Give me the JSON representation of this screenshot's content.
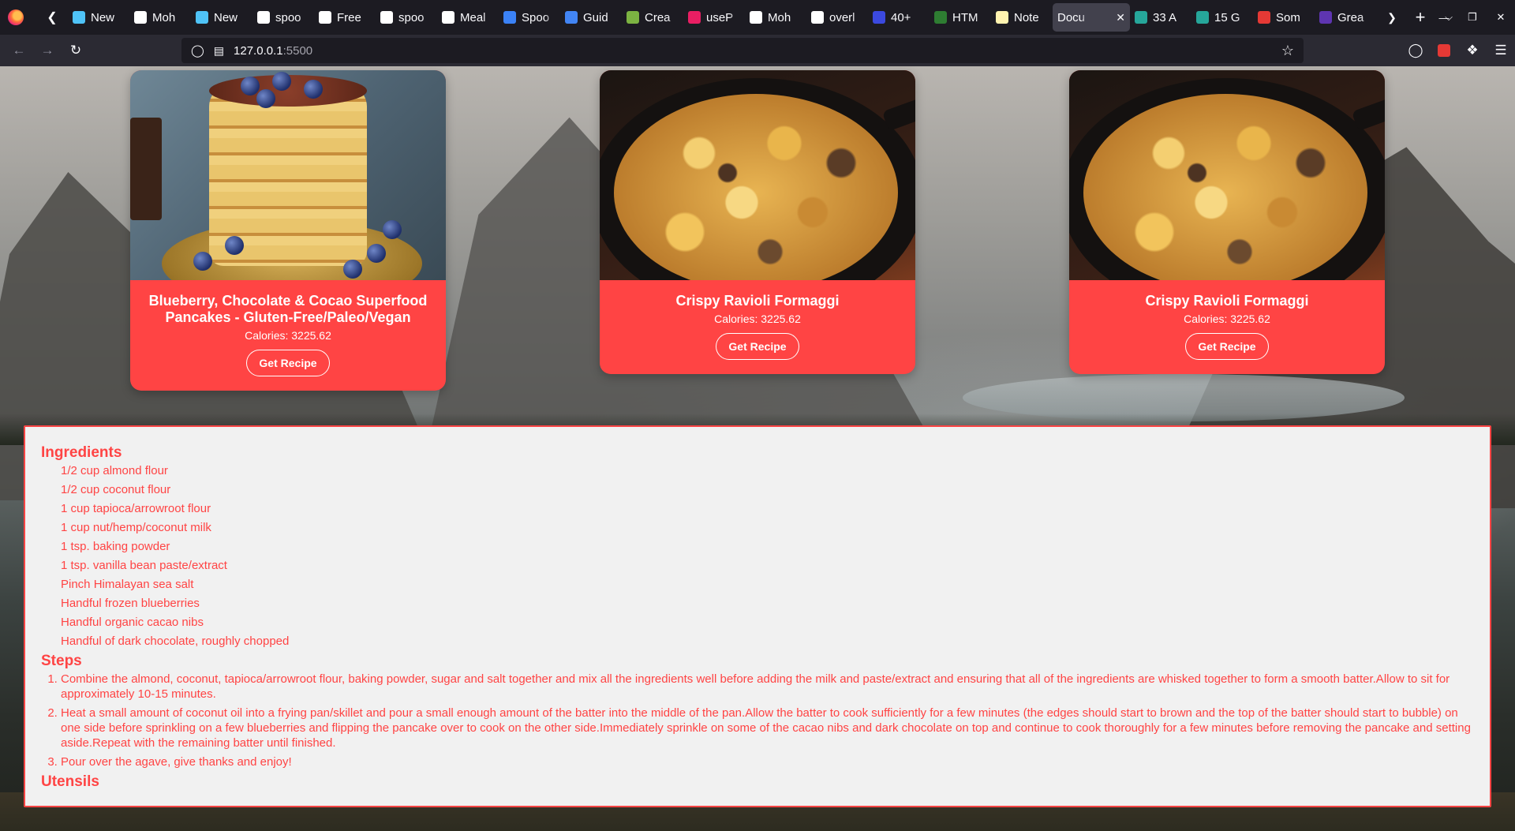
{
  "browser": {
    "tabs": [
      {
        "label": "New",
        "color": "#4fc3f7"
      },
      {
        "label": "Moh",
        "color": "#ffffff"
      },
      {
        "label": "New",
        "color": "#4fc3f7"
      },
      {
        "label": "spoo",
        "color": "#ffffff"
      },
      {
        "label": "Free",
        "color": "#ffffff"
      },
      {
        "label": "spoo",
        "color": "#ffffff"
      },
      {
        "label": "Meal",
        "color": "#ffffff"
      },
      {
        "label": "Spoo",
        "color": "#3b82f6"
      },
      {
        "label": "Guid",
        "color": "#4285f4"
      },
      {
        "label": "Crea",
        "color": "#7cb342"
      },
      {
        "label": "useP",
        "color": "#e91e63"
      },
      {
        "label": "Moh",
        "color": "#ffffff"
      },
      {
        "label": "overl",
        "color": "#ffffff"
      },
      {
        "label": "40+",
        "color": "#3b49df"
      },
      {
        "label": "HTM",
        "color": "#2e7d32"
      },
      {
        "label": "Note",
        "color": "#fff3b0"
      },
      {
        "label": "Docu",
        "color": "#42414d",
        "active": true
      },
      {
        "label": "33 A",
        "color": "#26a69a"
      },
      {
        "label": "15 G",
        "color": "#26a69a"
      },
      {
        "label": "Som",
        "color": "#e53935"
      },
      {
        "label": "Grea",
        "color": "#5e35b1"
      }
    ],
    "url_host": "127.0.0.1",
    "url_port": ":5500"
  },
  "cards": [
    {
      "title": "Blueberry, Chocolate & Cocao Superfood Pancakes - Gluten-Free/Paleo/Vegan",
      "calories": "Calories: 3225.62",
      "button": "Get Recipe",
      "image": "pancakes-photo"
    },
    {
      "title": "Crispy Ravioli Formaggi",
      "calories": "Calories: 3225.62",
      "button": "Get Recipe",
      "image": "ravioli-photo"
    },
    {
      "title": "Crispy Ravioli Formaggi",
      "calories": "Calories: 3225.62",
      "button": "Get Recipe",
      "image": "ravioli-photo"
    }
  ],
  "recipe": {
    "ingredients_heading": "Ingredients",
    "ingredients": [
      "1/2 cup almond flour",
      "1/2 cup coconut flour",
      "1 cup tapioca/arrowroot flour",
      "1 cup nut/hemp/coconut milk",
      "1 tsp. baking powder",
      "1 tsp. vanilla bean paste/extract",
      "Pinch Himalayan sea salt",
      "Handful frozen blueberries",
      "Handful organic cacao nibs",
      "Handful of dark chocolate, roughly chopped"
    ],
    "steps_heading": "Steps",
    "steps": [
      "Combine the almond, coconut, tapioca/arrowroot flour, baking powder, sugar and salt together and mix all the ingredients well before adding the milk and paste/extract and ensuring that all of the ingredients are whisked together to form a smooth batter.Allow to sit for approximately 10-15 minutes.",
      "Heat a small amount of coconut oil into a frying pan/skillet and pour a small enough amount of the batter into the middle of the pan.Allow the batter to cook sufficiently for a few minutes (the edges should start to brown and the top of the batter should start to bubble) on one side before sprinkling on a few blueberries and flipping the pancake over to cook on the other side.Immediately sprinkle on some of the cacao nibs and dark chocolate on top and continue to cook thoroughly for a few minutes before removing the pancake and setting aside.Repeat with the remaining batter until finished.",
      "Pour over the agave, give thanks and enjoy!"
    ],
    "utensils_heading": "Utensils"
  },
  "colors": {
    "accent": "#ff4444",
    "panel_bg": "#f1f1f1",
    "chrome_dark": "#1c1b22",
    "chrome_nav": "#2b2a33"
  }
}
